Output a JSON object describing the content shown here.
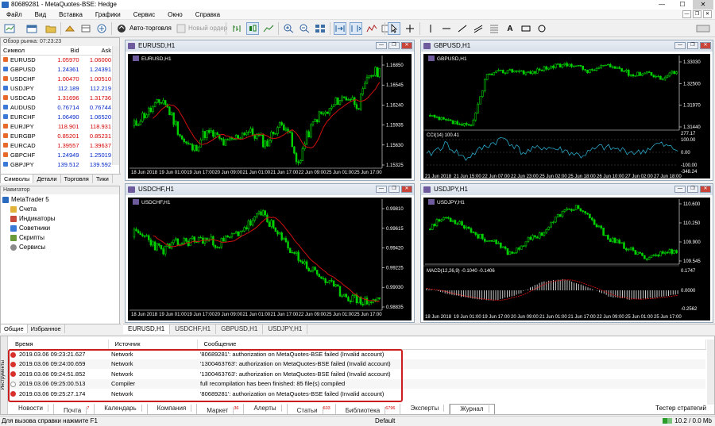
{
  "window": {
    "title": "80689281 - MetaQuotes-BSE: Hedge",
    "buttons": [
      "—",
      "☐",
      "✕"
    ]
  },
  "menu": [
    "Файл",
    "Вид",
    "Вставка",
    "Графики",
    "Сервис",
    "Окно",
    "Справка"
  ],
  "toolbar": {
    "autotrade": "Авто-торговля",
    "neworder": "Новый ордер"
  },
  "market_watch": {
    "header": "Обзор рынка: 07:23:23",
    "columns": [
      "Символ",
      "Bid",
      "Ask"
    ],
    "rows": [
      {
        "symbol": "EURUSD",
        "bid": "1.05970",
        "ask": "1.06000",
        "dir": "up"
      },
      {
        "symbol": "GBPUSD",
        "bid": "1.24361",
        "ask": "1.24391",
        "dir": "dn"
      },
      {
        "symbol": "USDCHF",
        "bid": "1.00470",
        "ask": "1.00510",
        "dir": "up"
      },
      {
        "symbol": "USDJPY",
        "bid": "112.189",
        "ask": "112.219",
        "dir": "dn"
      },
      {
        "symbol": "USDCAD",
        "bid": "1.31696",
        "ask": "1.31736",
        "dir": "up"
      },
      {
        "symbol": "AUDUSD",
        "bid": "0.76714",
        "ask": "0.76744",
        "dir": "dn"
      },
      {
        "symbol": "EURCHF",
        "bid": "1.06490",
        "ask": "1.06520",
        "dir": "dn"
      },
      {
        "symbol": "EURJPY",
        "bid": "118.901",
        "ask": "118.931",
        "dir": "up"
      },
      {
        "symbol": "EURGBP",
        "bid": "0.85201",
        "ask": "0.85231",
        "dir": "up"
      },
      {
        "symbol": "EURCAD",
        "bid": "1.39557",
        "ask": "1.39637",
        "dir": "up"
      },
      {
        "symbol": "GBPCHF",
        "bid": "1.24949",
        "ask": "1.25019",
        "dir": "up"
      },
      {
        "symbol": "GBPJPY",
        "bid": "139.512",
        "ask": "139.592",
        "dir": "dn"
      }
    ],
    "tabs": [
      "Символы",
      "Детали",
      "Торговля",
      "Тики"
    ]
  },
  "navigator": {
    "header": "Навигатор",
    "items": [
      "MetaTrader 5",
      "Счета",
      "Индикаторы",
      "Советники",
      "Скрипты",
      "Сервисы"
    ],
    "tabs": [
      "Общие",
      "Избранное"
    ]
  },
  "charts": [
    {
      "title": "EURUSD,H1",
      "label": "EURUSD,H1",
      "prices": [
        "1.16850",
        "1.16545",
        "1.16240",
        "1.15935",
        "1.15630",
        "1.15325"
      ],
      "dates": [
        "18 Jun 2018",
        "19 Jun 01:00",
        "19 Jun 17:00",
        "20 Jun 09:00",
        "21 Jun 01:00",
        "21 Jun 17:00",
        "22 Jun 09:00",
        "25 Jun 01:00",
        "25 Jun 17:00"
      ]
    },
    {
      "title": "GBPUSD,H1",
      "label": "GBPUSD,H1",
      "prices": [
        "1.33030",
        "1.32500",
        "1.31970",
        "1.31440"
      ],
      "cci_label": "CCI(14) 100.41",
      "cci_levels": [
        "277.17",
        "100.00",
        "0.00",
        "-100.00",
        "-348.24"
      ],
      "dates": [
        "21 Jun 2018",
        "21 Jun 15:00",
        "22 Jun 07:00",
        "22 Jun 23:00",
        "25 Jun 02:00",
        "25 Jun 18:00",
        "26 Jun 10:00",
        "27 Jun 02:00",
        "27 Jun 18:00"
      ]
    },
    {
      "title": "USDCHF,H1",
      "label": "USDCHF,H1",
      "prices": [
        "0.99810",
        "0.99615",
        "0.99420",
        "0.99225",
        "0.99030",
        "0.98835"
      ],
      "dates": [
        "18 Jun 2018",
        "19 Jun 01:00",
        "19 Jun 17:00",
        "20 Jun 09:00",
        "21 Jun 01:00",
        "21 Jun 17:00",
        "22 Jun 09:00",
        "25 Jun 01:00",
        "25 Jun 17:00"
      ]
    },
    {
      "title": "USDJPY,H1",
      "label": "USDJPY,H1",
      "prices": [
        "110.600",
        "110.250",
        "109.900",
        "109.545"
      ],
      "macd_label": "MACD(12,26,9) -0.1040 -0.1406",
      "macd_levels": [
        "0.1747",
        "0.0000",
        "-0.2562"
      ],
      "dates": [
        "18 Jun 2018",
        "19 Jun 01:00",
        "19 Jun 17:00",
        "20 Jun 09:00",
        "21 Jun 01:00",
        "21 Jun 17:00",
        "22 Jun 09:00",
        "25 Jun 01:00",
        "25 Jun 17:00"
      ]
    }
  ],
  "chart_tabs": [
    "EURUSD,H1",
    "USDCHF,H1",
    "GBPUSD,H1",
    "USDJPY,H1"
  ],
  "journal": {
    "columns": [
      "Время",
      "Источник",
      "Сообщение"
    ],
    "rows": [
      {
        "time": "2019.03.06 09:23:21.627",
        "source": "Network",
        "message": "'80689281': authorization on MetaQuotes-BSE failed (Invalid account)",
        "level": "error"
      },
      {
        "time": "2019.03.06 09:24:00.659",
        "source": "Network",
        "message": "'1300463763': authorization on MetaQuotes-BSE failed (Invalid account)",
        "level": "error"
      },
      {
        "time": "2019.03.06 09:24:51.852",
        "source": "Network",
        "message": "'1300463763': authorization on MetaQuotes-BSE failed (Invalid account)",
        "level": "error"
      },
      {
        "time": "2019.03.06 09:25:00.513",
        "source": "Compiler",
        "message": "full recompilation has been finished: 85 file(s) compiled",
        "level": "info"
      },
      {
        "time": "2019.03.06 09:25:27.174",
        "source": "Network",
        "message": "'80689281': authorization on MetaQuotes-BSE failed (Invalid account)",
        "level": "error"
      }
    ],
    "side_label": "Инструменты",
    "tabs": [
      {
        "label": "Новости",
        "badge": ""
      },
      {
        "label": "Почта",
        "badge": "7"
      },
      {
        "label": "Календарь",
        "badge": ""
      },
      {
        "label": "Компания",
        "badge": ""
      },
      {
        "label": "Маркет",
        "badge": "36"
      },
      {
        "label": "Алерты",
        "badge": ""
      },
      {
        "label": "Статьи",
        "badge": "603"
      },
      {
        "label": "Библиотека",
        "badge": "6796"
      },
      {
        "label": "Эксперты",
        "badge": ""
      },
      {
        "label": "Журнал",
        "badge": ""
      }
    ],
    "tester": "Тестер стратегий"
  },
  "status": {
    "help": "Для вызова справки нажмите F1",
    "profile": "Default",
    "traffic": "10.2 / 0.0 Mb"
  },
  "colors": {
    "bull": "#00d000",
    "bear": "#00d000",
    "ma": "#d01010",
    "cci": "#2aa8c8",
    "macd": "#c8c8c8",
    "signal": "#d01010",
    "error": "#d9302c",
    "highlight": "#c81e1e"
  }
}
